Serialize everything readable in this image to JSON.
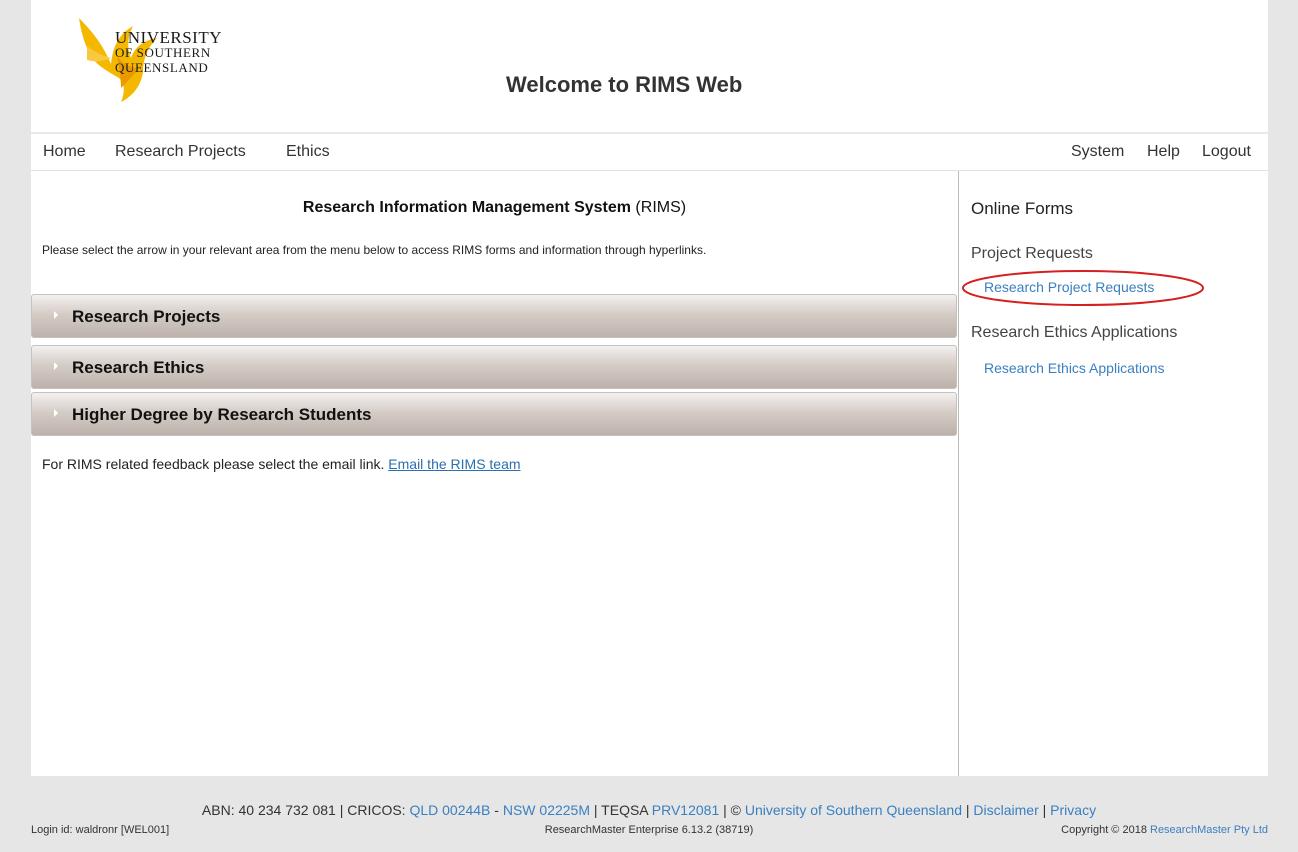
{
  "header": {
    "logo_line1": "UNIVERSITY",
    "logo_line2": "OF SOUTHERN",
    "logo_line3": "QUEENSLAND",
    "welcome": "Welcome to RIMS Web"
  },
  "nav": {
    "left": [
      "Home",
      "Research Projects",
      "Ethics"
    ],
    "right": [
      "System",
      "Help",
      "Logout"
    ]
  },
  "main": {
    "title_bold": "Research Information Management System",
    "title_suffix": " (RIMS)",
    "instructions": "Please select the arrow in your relevant area from the menu below to access RIMS forms and information through hyperlinks.",
    "sections": [
      "Research Projects",
      "Research Ethics",
      "Higher Degree by Research Students"
    ],
    "feedback_text": "For RIMS related feedback please select the email link. ",
    "feedback_link": "Email the RIMS team"
  },
  "sidebar": {
    "heading": "Online Forms",
    "group1_title": "Project Requests",
    "group1_link": "Research Project Requests",
    "group2_title": "Research Ethics Applications",
    "group2_link": "Research Ethics Applications",
    "highlight_color": "#d62020"
  },
  "footer": {
    "abn": "ABN: 40 234 732 081 | CRICOS: ",
    "qld": "QLD 00244B",
    "dash": " - ",
    "nsw": "NSW 02225M",
    "teqsa": " | TEQSA ",
    "prv": "PRV12081",
    "copy_sep": " | © ",
    "usq": "University of Southern Queensland",
    "sep1": " | ",
    "disclaimer": "Disclaimer",
    "sep2": " | ",
    "privacy": "Privacy",
    "login": "Login id: waldronr [WEL001]",
    "version": "ResearchMaster Enterprise 6.13.2 (38719)",
    "copyright": "Copyright © 2018 ",
    "rm": "ResearchMaster Pty Ltd"
  },
  "colors": {
    "link": "#3a7fc0",
    "bar": "#c9c0ba",
    "logo": "#f2b400"
  }
}
